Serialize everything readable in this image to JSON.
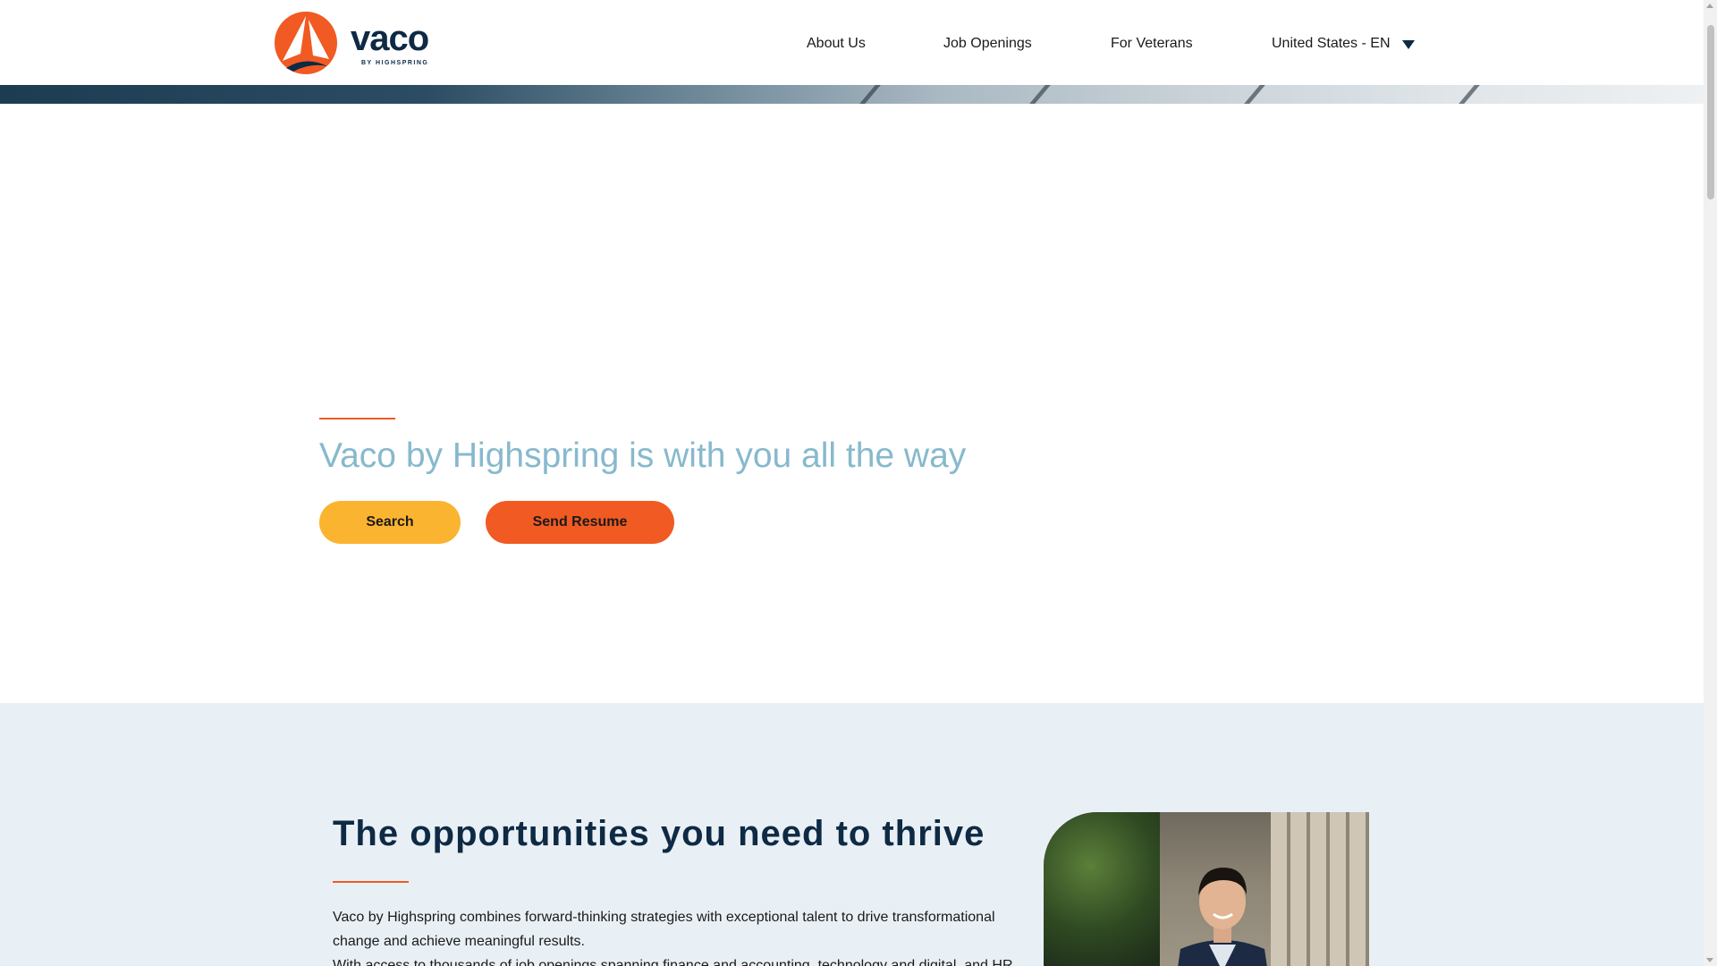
{
  "brand": {
    "name": "vaco",
    "tagline": "BY HIGHSPRING",
    "colors": {
      "primary": "#0e2a44",
      "accent": "#f15a22",
      "secondary": "#fbb430",
      "hero_title": "#87b9cd"
    }
  },
  "nav": {
    "items": [
      {
        "label": "About Us"
      },
      {
        "label": "Job Openings"
      },
      {
        "label": "For Veterans"
      },
      {
        "label": "United States - EN"
      }
    ],
    "region_icon": "caret-down-icon"
  },
  "hero": {
    "title": "Vaco by Highspring is with you all the way",
    "search_label": "Search",
    "send_resume_label": "Send Resume"
  },
  "section2": {
    "title": "The opportunities you need to thrive",
    "paragraphs": [
      "Vaco by Highspring combines forward-thinking strategies with exceptional talent to drive transformational change and achieve meaningful results.",
      "With access to thousands of job openings spanning finance and accounting, technology and digital, and HR"
    ]
  }
}
